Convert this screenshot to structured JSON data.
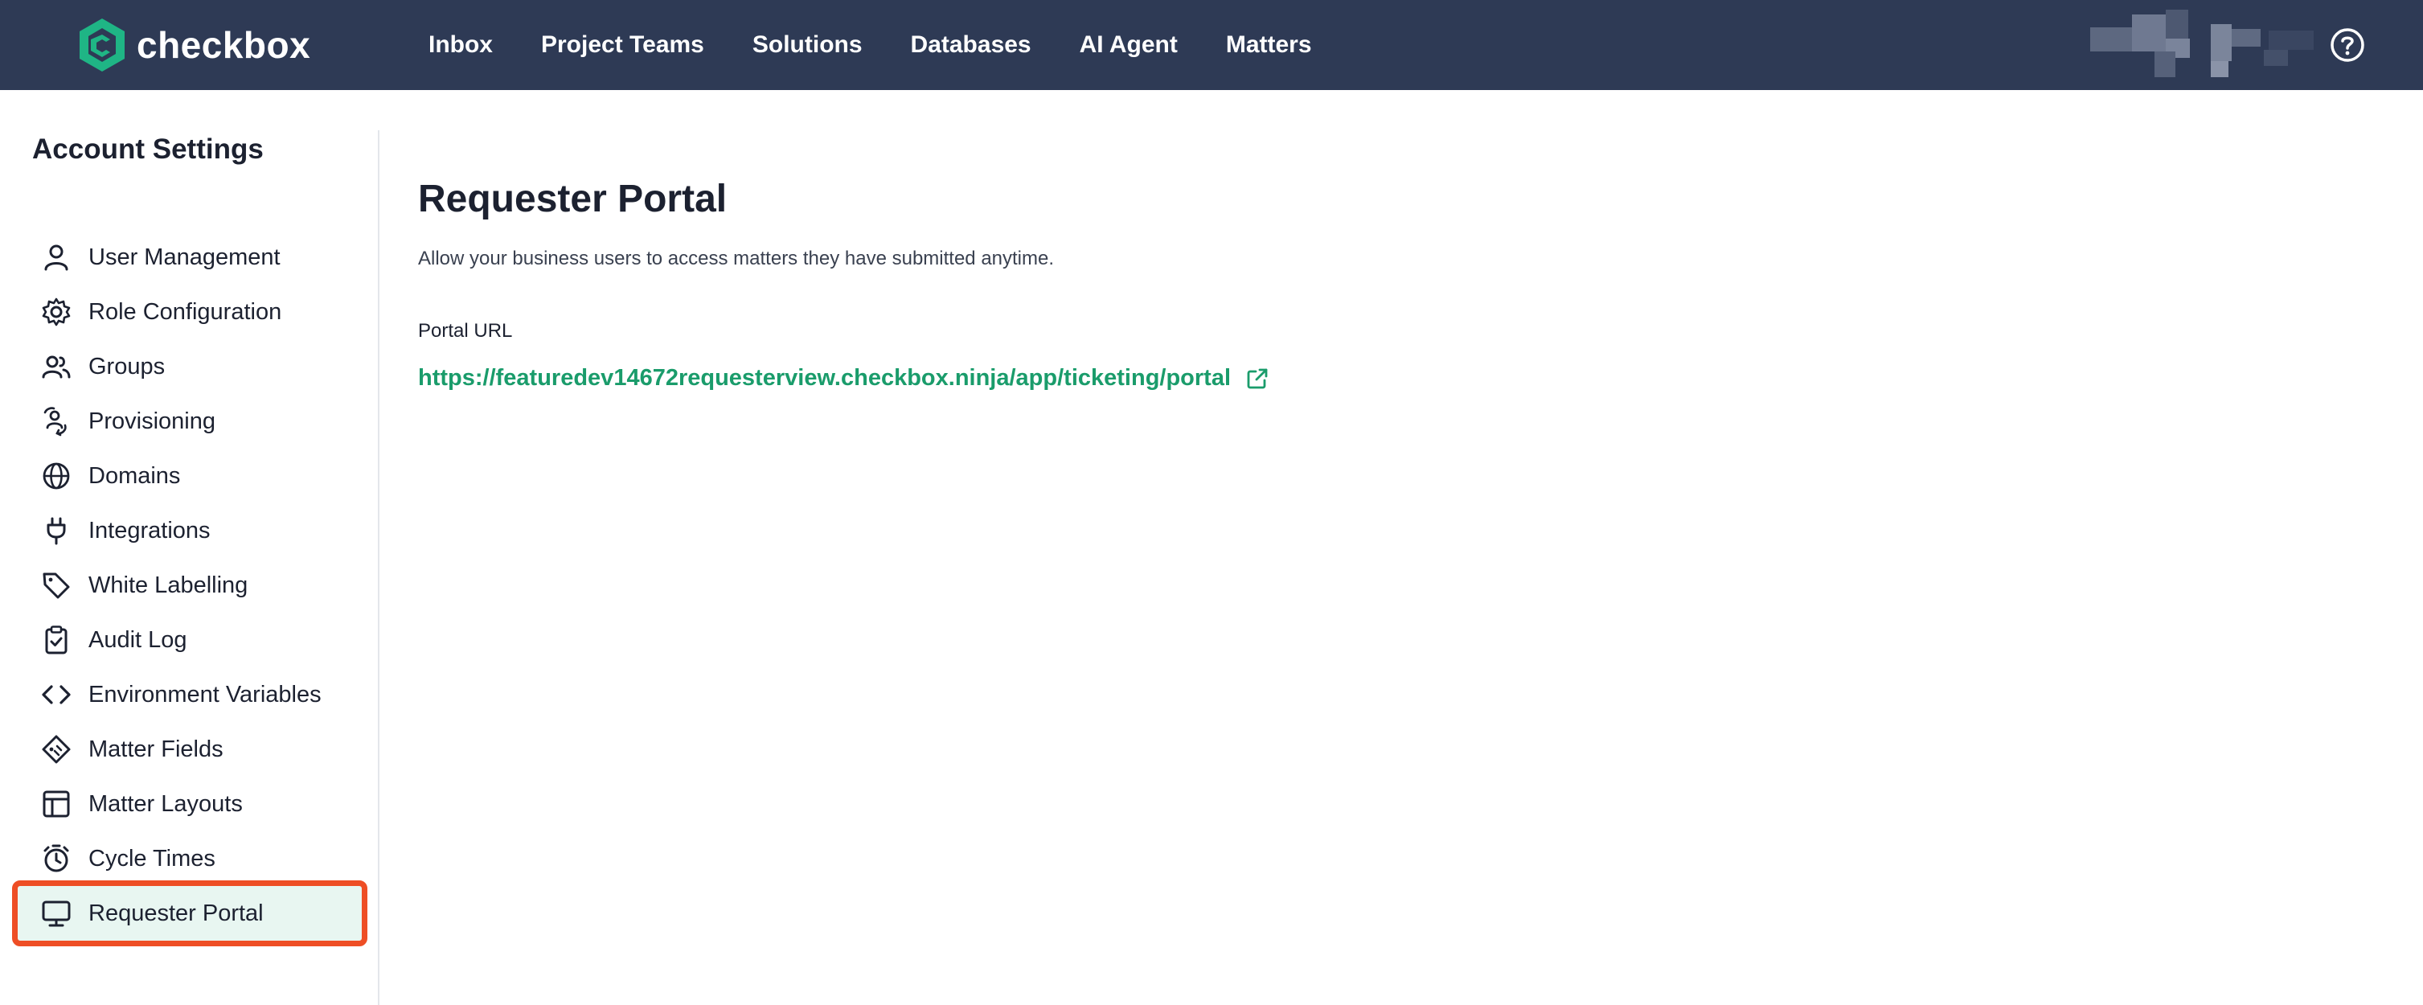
{
  "brand": {
    "name": "checkbox",
    "accent_color": "#1a9c6b",
    "header_color": "#2e3a55"
  },
  "nav": {
    "items": [
      {
        "label": "Inbox"
      },
      {
        "label": "Project Teams"
      },
      {
        "label": "Solutions"
      },
      {
        "label": "Databases"
      },
      {
        "label": "AI Agent"
      },
      {
        "label": "Matters"
      }
    ]
  },
  "header": {
    "help_icon": "help-circle-icon",
    "user_avatar": "pixelated-avatar"
  },
  "sidebar": {
    "title": "Account Settings",
    "items": [
      {
        "label": "User Management",
        "icon": "user-icon"
      },
      {
        "label": "Role Configuration",
        "icon": "gear-icon"
      },
      {
        "label": "Groups",
        "icon": "users-icon"
      },
      {
        "label": "Provisioning",
        "icon": "provisioning-icon"
      },
      {
        "label": "Domains",
        "icon": "globe-icon"
      },
      {
        "label": "Integrations",
        "icon": "plug-icon"
      },
      {
        "label": "White Labelling",
        "icon": "tag-icon"
      },
      {
        "label": "Audit Log",
        "icon": "clipboard-check-icon"
      },
      {
        "label": "Environment Variables",
        "icon": "code-icon"
      },
      {
        "label": "Matter Fields",
        "icon": "field-tag-icon"
      },
      {
        "label": "Matter Layouts",
        "icon": "layout-icon"
      },
      {
        "label": "Cycle Times",
        "icon": "stopwatch-icon"
      },
      {
        "label": "Requester Portal",
        "icon": "monitor-icon",
        "active": true
      }
    ],
    "active_highlight_color": "#ee4e25"
  },
  "main": {
    "title": "Requester Portal",
    "description": "Allow your business users to access matters they have submitted anytime.",
    "portal_url_label": "Portal URL",
    "portal_url": "https://featuredev14672requesterview.checkbox.ninja/app/ticketing/portal",
    "link_icon": "external-link-icon"
  }
}
